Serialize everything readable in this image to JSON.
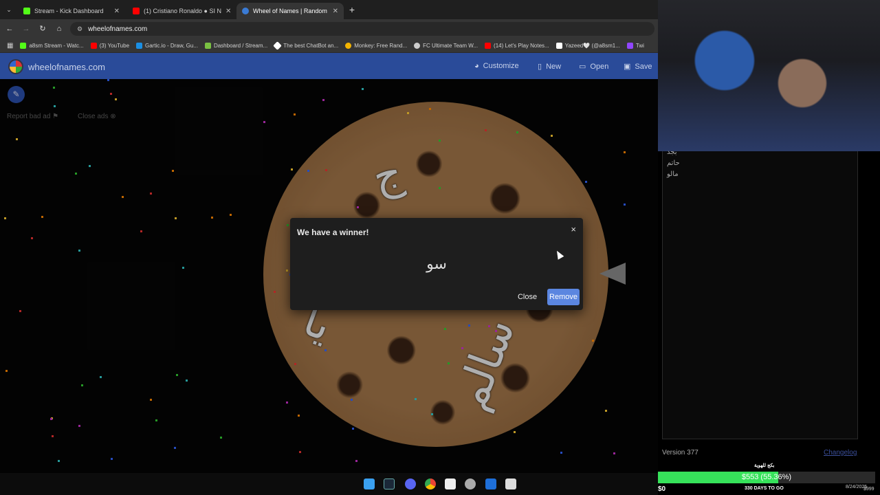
{
  "browser": {
    "tabs": [
      {
        "label": "Stream - Kick Dashboard",
        "color": "#53fc18"
      },
      {
        "label": "(1) Cristiano Ronaldo ● SI N",
        "color": "#ff0000"
      },
      {
        "label": "Wheel of Names | Random",
        "color": "#3a7bd5"
      }
    ],
    "url": "wheelofnames.com",
    "bookmarks": [
      {
        "label": "a8sm Stream - Watc...",
        "color": "#53fc18"
      },
      {
        "label": "(3) YouTube",
        "color": "#ff0000"
      },
      {
        "label": "Gartic.io - Draw, Gu...",
        "color": "#1a8fe3"
      },
      {
        "label": "Dashboard / Stream...",
        "color": "#7ac142"
      },
      {
        "label": "The best ChatBot an...",
        "color": "#ffffff"
      },
      {
        "label": "Monkey: Free Rand...",
        "color": "#f4b400"
      },
      {
        "label": "FC Ultimate Team W...",
        "color": "#cccccc"
      },
      {
        "label": "(14) Let's Play Notes...",
        "color": "#ff0000"
      },
      {
        "label": "Yazeed🤍 (@a8sm1...",
        "color": "#ffffff"
      },
      {
        "label": "Twi",
        "color": "#9146ff"
      }
    ]
  },
  "site": {
    "name": "wheelofnames.com",
    "nav": {
      "customize": "Customize",
      "new": "New",
      "open": "Open",
      "save": "Save"
    },
    "report_ad": "Report bad ad",
    "close_ads": "Close ads"
  },
  "wheel": {
    "labels": [
      "ج",
      "سالم",
      "يا"
    ]
  },
  "dialog": {
    "title": "We have a winner!",
    "winner": "سو",
    "close_label": "Close",
    "remove_label": "Remove",
    "close_icon": "×"
  },
  "entries": [
    "بجد",
    "حاتم",
    "مالو"
  ],
  "footer": {
    "version": "Version 377",
    "changelog": "Changelog"
  },
  "goal": {
    "title": "بكج للهوية",
    "amount_text": "$553 (55.36%)",
    "progress": 0.5536,
    "start": "$0",
    "days_left": "330 DAYS TO GO",
    "date": "8/24/2025",
    "target": "$999"
  },
  "colors": {
    "header": "#2a4b99",
    "remove_button": "#5b86e0",
    "goal_fill": "#36e25a"
  }
}
